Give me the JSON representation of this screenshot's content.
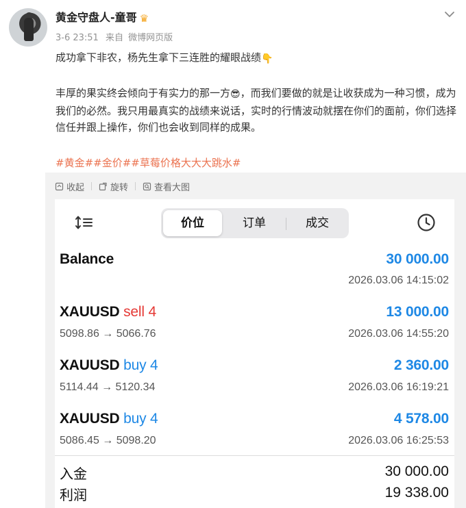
{
  "post": {
    "author": "黄金守盘人-童哥",
    "crown_icon": "crown-icon",
    "date": "3-6 23:51",
    "source_prefix": "来自",
    "source": "微博网页版",
    "line1": "成功拿下非农，杨先生拿下三连胜的耀眼战绩",
    "line1_emoji": "👇",
    "para2_a": "丰厚的果实终会倾向于有实力的那一方",
    "para2_emoji": "😎",
    "para2_b": "，而我们要做的就是让收获成为一种习惯，成为我们的必然。我只用最真实的战绩来说话，实时的行情波动就摆在你们的面前，你们选择信任并跟上操作，你们也会收到同样的成果。",
    "tags": [
      "#黄金#",
      "#金价#",
      "#草莓价格大大大跳水#"
    ]
  },
  "image_toolbar": {
    "collect": "收起",
    "rotate": "旋转",
    "view_large": "查看大图"
  },
  "trade_app": {
    "tabs": [
      "价位",
      "订单",
      "成交"
    ],
    "active_tab": "价位",
    "balance": {
      "label": "Balance",
      "amount": "30 000.00",
      "time": "2026.03.06 14:15:02"
    },
    "deals": [
      {
        "symbol": "XAUUSD",
        "side": "sell 4",
        "prices": "5098.86 → 5066.76",
        "profit": "13 000.00",
        "time": "2026.03.06 14:55:20"
      },
      {
        "symbol": "XAUUSD",
        "side": "buy 4",
        "prices": "5114.44 → 5120.34",
        "profit": "2 360.00",
        "time": "2026.03.06 16:19:21"
      },
      {
        "symbol": "XAUUSD",
        "side": "buy 4",
        "prices": "5086.45 → 5098.20",
        "profit": "4 578.00",
        "time": "2026.03.06 16:25:53"
      }
    ],
    "summary": {
      "deposit_label": "入金",
      "deposit_value": "30 000.00",
      "profit_label": "利润",
      "profit_value": "19 338.00"
    }
  },
  "colors": {
    "tag": "#eb7350",
    "amount_blue": "#1e88e5",
    "sell_red": "#e53935"
  }
}
